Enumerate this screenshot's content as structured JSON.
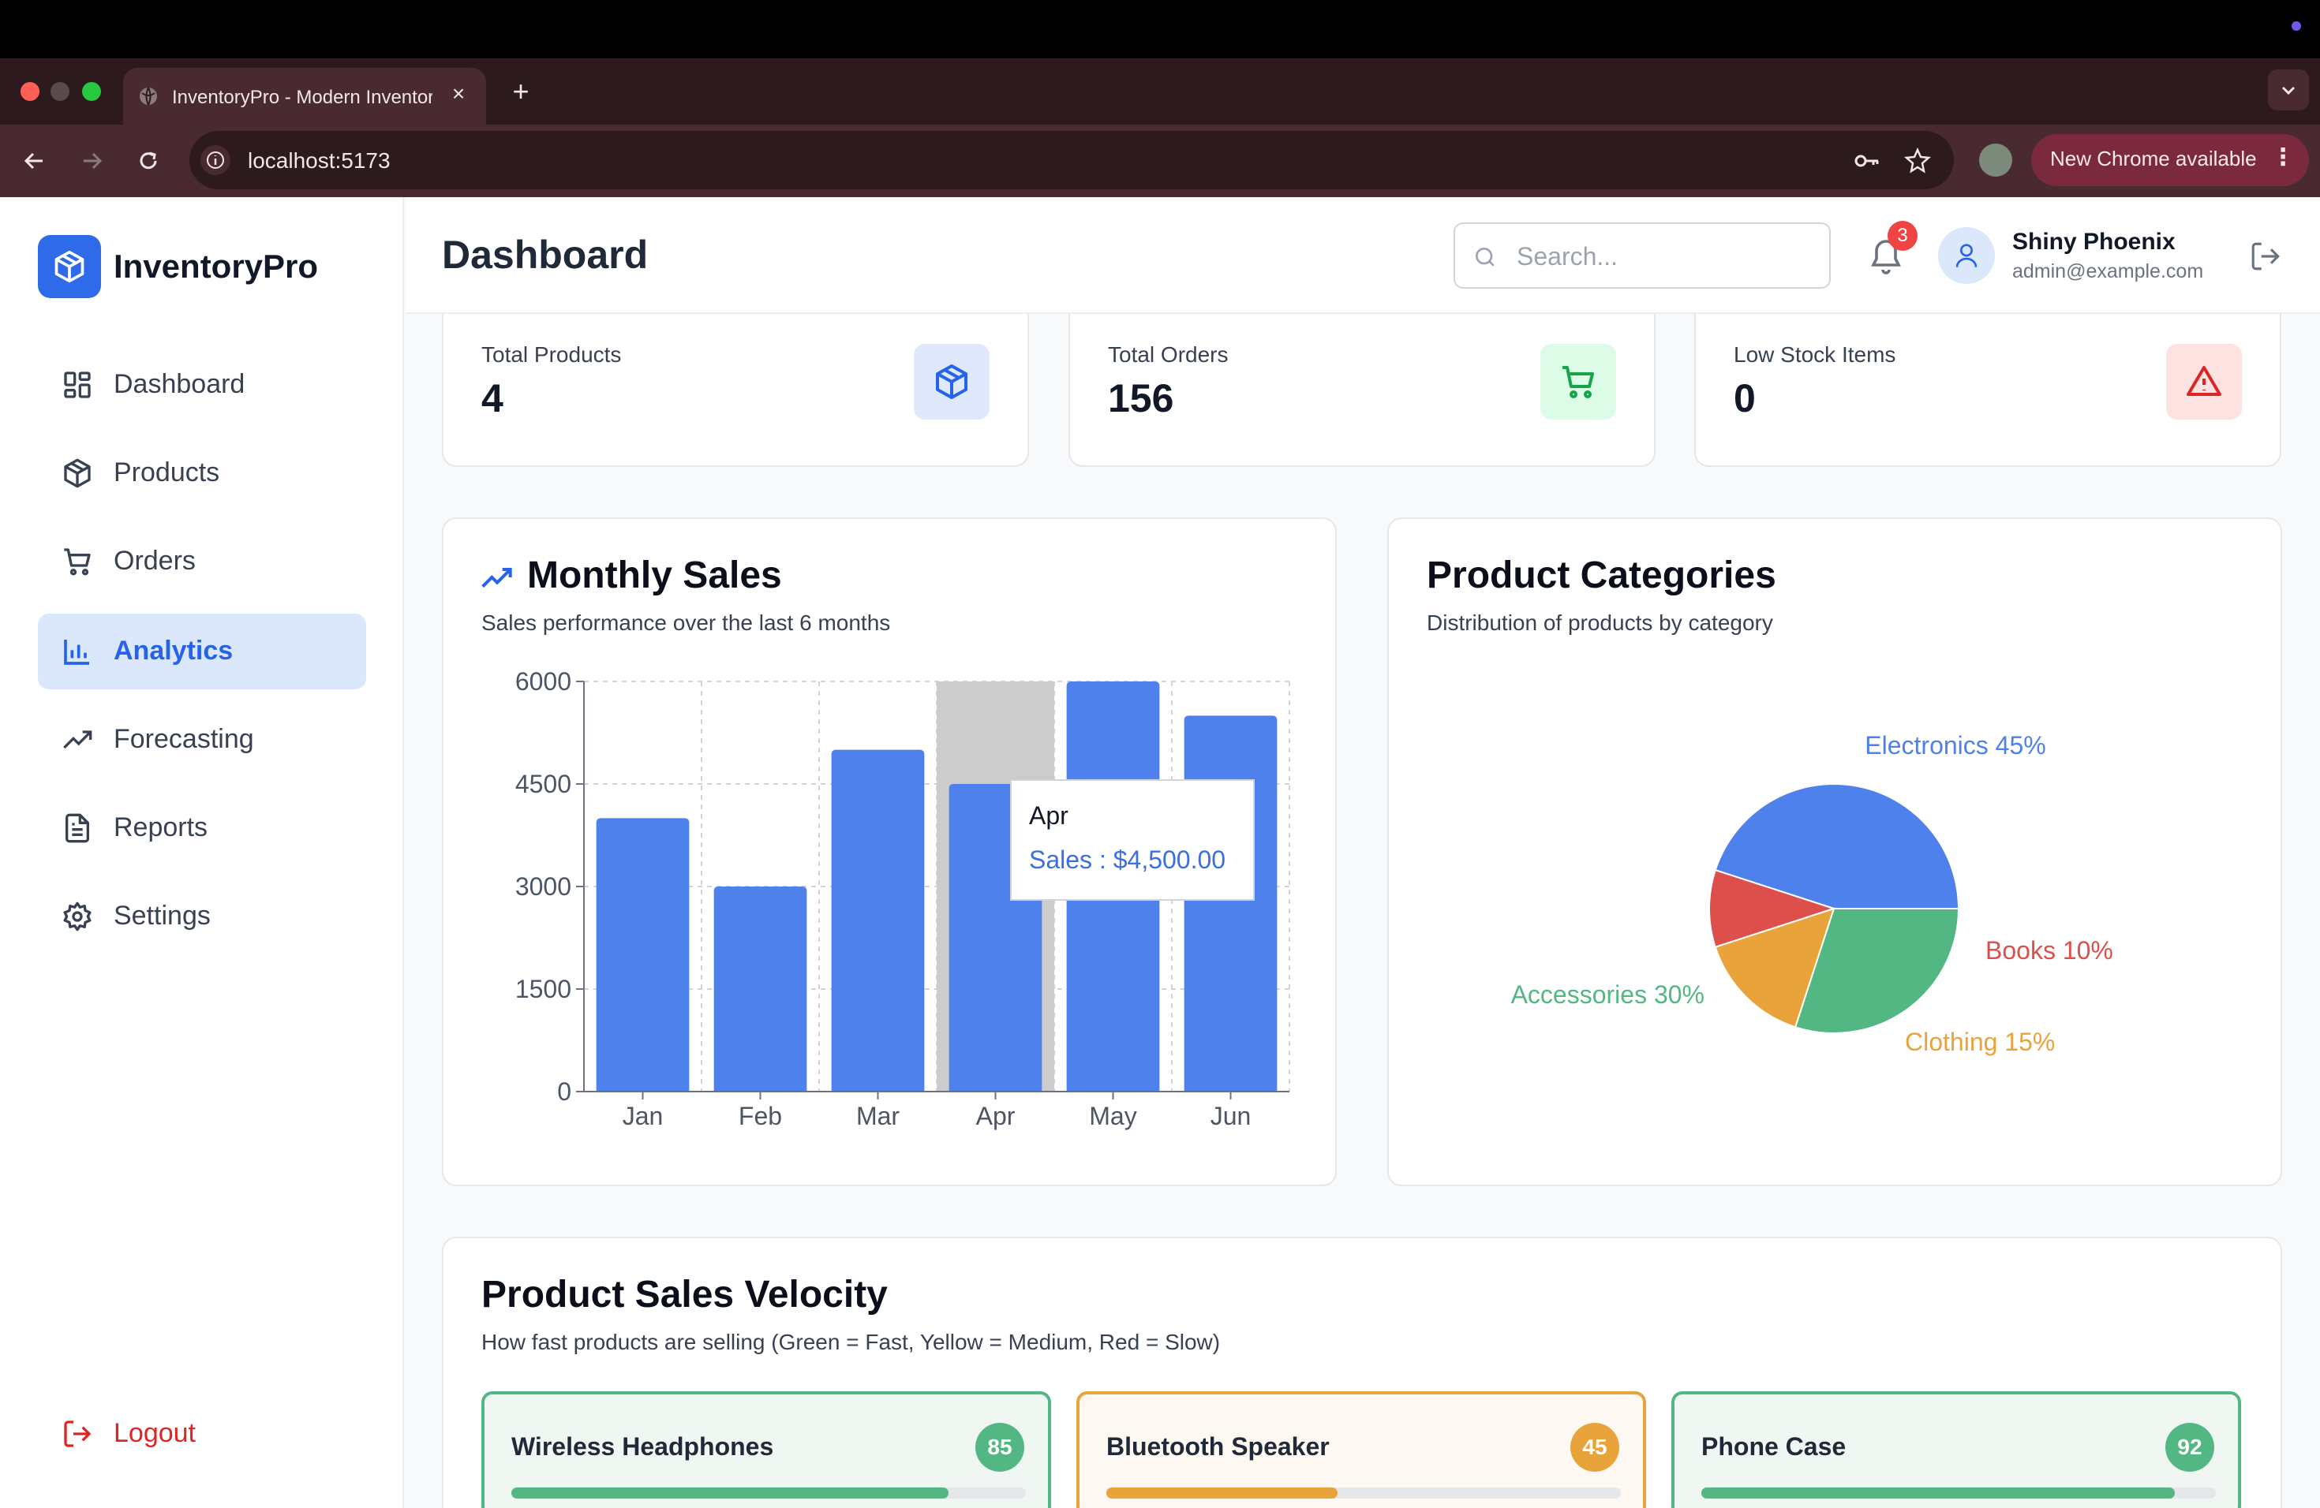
{
  "browser": {
    "tab_title": "InventoryPro - Modern Inventory Management",
    "url": "localhost:5173",
    "update_label": "New Chrome available"
  },
  "app": {
    "brand": "InventoryPro",
    "accent": "#2f6ae8"
  },
  "sidebar": {
    "items": [
      {
        "label": "Dashboard",
        "icon": "dashboard-icon"
      },
      {
        "label": "Products",
        "icon": "box-icon"
      },
      {
        "label": "Orders",
        "icon": "cart-icon"
      },
      {
        "label": "Analytics",
        "icon": "bar-chart-icon",
        "active": true
      },
      {
        "label": "Forecasting",
        "icon": "trend-icon"
      },
      {
        "label": "Reports",
        "icon": "document-icon"
      },
      {
        "label": "Settings",
        "icon": "gear-icon"
      }
    ],
    "logout_label": "Logout"
  },
  "header": {
    "title": "Dashboard",
    "search_placeholder": "Search...",
    "notification_count": "3",
    "user_name": "Shiny Phoenix",
    "user_email": "admin@example.com"
  },
  "stats": [
    {
      "label": "Total Products",
      "value": "4",
      "icon": "box-icon",
      "color": "#2563eb",
      "bg": "#e0e9fb"
    },
    {
      "label": "Total Orders",
      "value": "156",
      "icon": "cart-icon",
      "color": "#16a34a",
      "bg": "#dcfce7"
    },
    {
      "label": "Low Stock Items",
      "value": "0",
      "icon": "warning-icon",
      "color": "#dc2626",
      "bg": "#fde2e2"
    }
  ],
  "monthly_sales": {
    "title": "Monthly Sales",
    "subtitle": "Sales performance over the last 6 months",
    "tooltip": {
      "month": "Apr",
      "text": "Sales : $4,500.00"
    }
  },
  "product_categories": {
    "title": "Product Categories",
    "subtitle": "Distribution of products by category"
  },
  "chart_data": [
    {
      "type": "bar",
      "title": "Monthly Sales",
      "categories": [
        "Jan",
        "Feb",
        "Mar",
        "Apr",
        "May",
        "Jun"
      ],
      "values": [
        4000,
        3000,
        5000,
        4500,
        6000,
        5500
      ],
      "ylim": [
        0,
        6000
      ],
      "yticks": [
        0,
        1500,
        3000,
        4500,
        6000
      ],
      "grid": true,
      "bar_color": "#4f81ec",
      "highlight": "Apr"
    },
    {
      "type": "pie",
      "title": "Product Categories",
      "slices": [
        {
          "label": "Electronics",
          "value": 45,
          "color": "#4f81ec",
          "text": "Electronics 45%"
        },
        {
          "label": "Books",
          "value": 10,
          "color": "#dc4f4a",
          "text": "Books 10%"
        },
        {
          "label": "Clothing",
          "value": 15,
          "color": "#e8a33a",
          "text": "Clothing 15%"
        },
        {
          "label": "Accessories",
          "value": 30,
          "color": "#53b783",
          "text": "Accessories 30%"
        }
      ]
    }
  ],
  "velocity": {
    "title": "Product Sales Velocity",
    "subtitle": "How fast products are selling (Green = Fast, Yellow = Medium, Red = Slow)",
    "items": [
      {
        "name": "Wireless Headphones",
        "score": "85",
        "level": 0.85,
        "color": "#53b783",
        "bg": "#f0f7f3"
      },
      {
        "name": "Bluetooth Speaker",
        "score": "45",
        "level": 0.45,
        "color": "#e8a33a",
        "bg": "#fdf8f1"
      },
      {
        "name": "Phone Case",
        "score": "92",
        "level": 0.92,
        "color": "#53b783",
        "bg": "#f0f7f3"
      }
    ]
  }
}
